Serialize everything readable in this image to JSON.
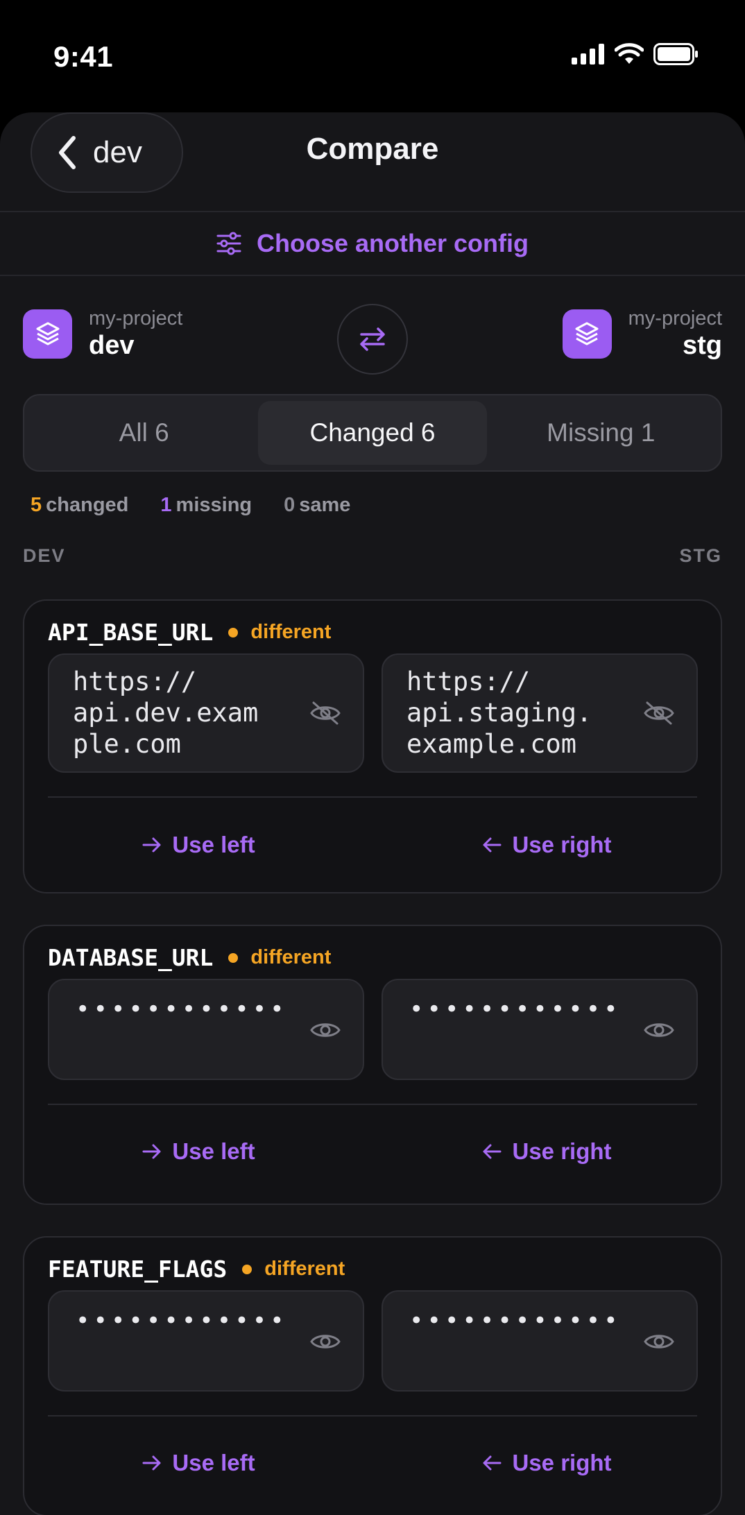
{
  "status_bar": {
    "time": "9:41"
  },
  "nav": {
    "back_label": "dev",
    "title": "Compare"
  },
  "choose_config": {
    "label": "Choose another config"
  },
  "left_env": {
    "project": "my-project",
    "name": "dev"
  },
  "right_env": {
    "project": "my-project",
    "name": "stg"
  },
  "tabs": [
    {
      "label": "All 6",
      "active": false
    },
    {
      "label": "Changed 6",
      "active": true
    },
    {
      "label": "Missing 1",
      "active": false
    }
  ],
  "summary": {
    "changed_count": "5",
    "changed_label": "changed",
    "missing_count": "1",
    "missing_label": "missing",
    "same_count": "0",
    "same_label": "same"
  },
  "columns": {
    "left": "DEV",
    "right": "STG"
  },
  "cards": [
    {
      "key": "API_BASE_URL",
      "status": "different",
      "left_value": "https://\napi.dev.exam\nple.com",
      "right_value": "https://\napi.staging.\nexample.com",
      "use_left": "Use left",
      "use_right": "Use right"
    },
    {
      "key": "DATABASE_URL",
      "status": "different",
      "left_value": "••••••••••••",
      "right_value": "••••••••••••",
      "use_left": "Use left",
      "use_right": "Use right"
    },
    {
      "key": "FEATURE_FLAGS",
      "status": "different",
      "left_value": "••••••••••••",
      "right_value": "••••••••••••",
      "use_left": "Use left",
      "use_right": "Use right"
    }
  ],
  "colors": {
    "accent": "#a86bf5",
    "warning": "#f5a524",
    "background": "#161619"
  },
  "icons": {
    "back": "chevron-left-icon",
    "choose": "sliders-icon",
    "env": "layers-icon",
    "swap": "swap-arrows-icon",
    "visible_hide": "eye-off-icon",
    "masked_show": "eye-icon",
    "use_left": "arrow-right-icon",
    "use_right": "arrow-left-icon"
  }
}
